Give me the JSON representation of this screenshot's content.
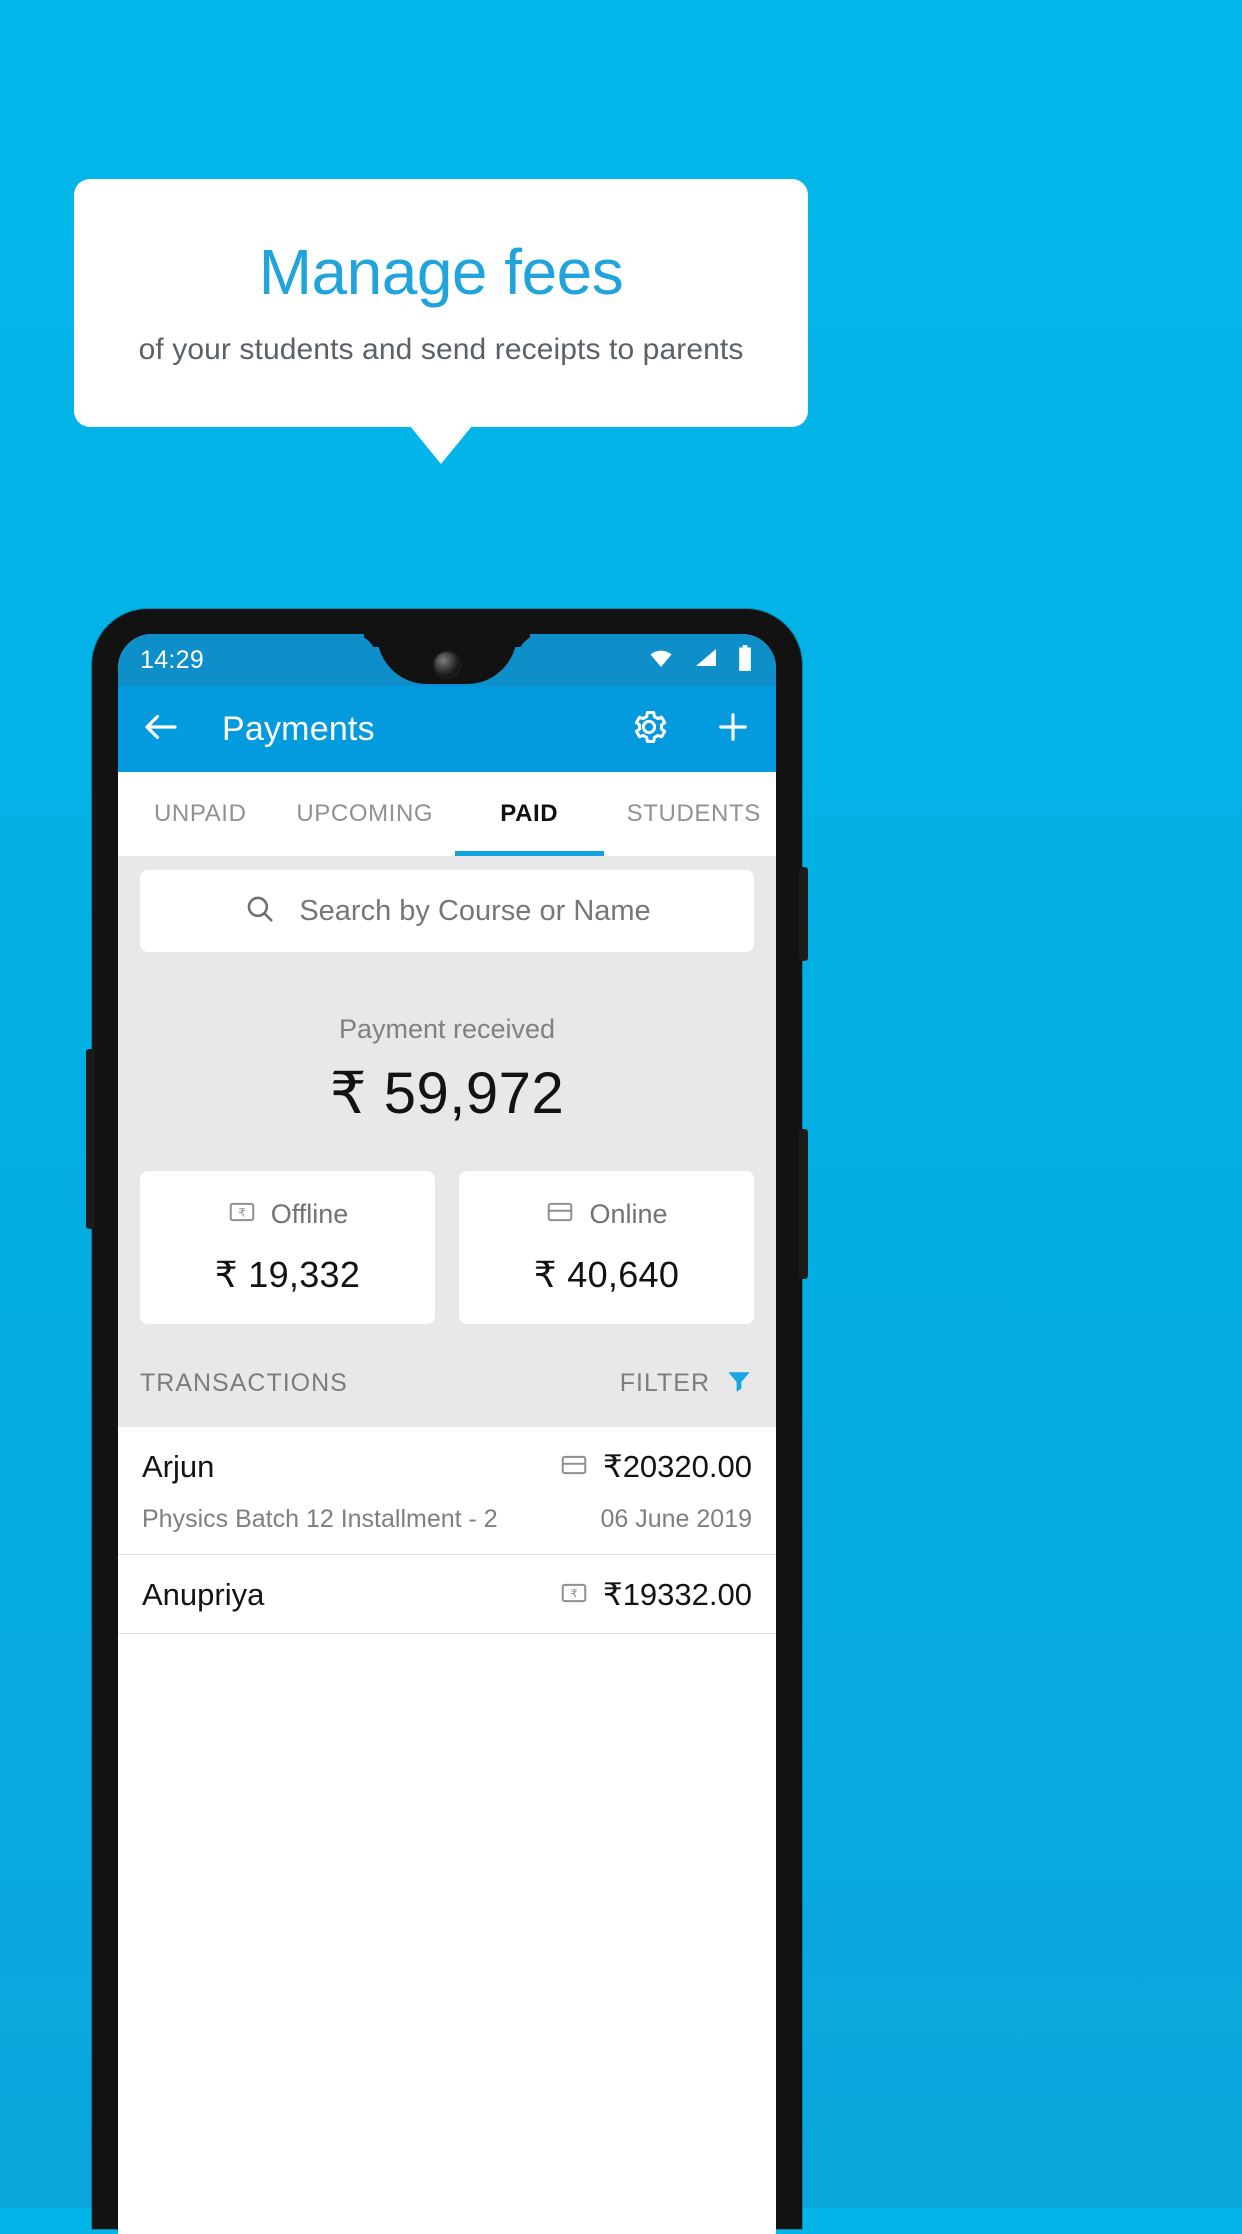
{
  "promo": {
    "title": "Manage fees",
    "subtitle": "of your students and send receipts to parents"
  },
  "colors": {
    "background": "#03b4e8",
    "bubble_title": "#21a3dc",
    "appbar": "#039ade",
    "statusbar": "#0e8fc9",
    "accent": "#11a2e0",
    "body": "#e8e8e8"
  },
  "phone": {
    "statusbar": {
      "time": "14:29",
      "icons": [
        "wifi-icon",
        "signal-icon",
        "battery-icon"
      ]
    },
    "appbar": {
      "back_icon": "back-arrow-icon",
      "title": "Payments",
      "settings_icon": "gear-icon",
      "add_icon": "plus-icon"
    },
    "tabs": [
      {
        "label": "UNPAID",
        "active": false
      },
      {
        "label": "UPCOMING",
        "active": false
      },
      {
        "label": "PAID",
        "active": true
      },
      {
        "label": "STUDENTS",
        "active": false
      }
    ],
    "search": {
      "icon": "search-icon",
      "placeholder": "Search by Course or Name",
      "value": ""
    },
    "summary": {
      "label": "Payment received",
      "amount": "₹ 59,972"
    },
    "payment_cards": [
      {
        "icon": "rupee-note-icon",
        "label": "Offline",
        "amount": "₹ 19,332"
      },
      {
        "icon": "credit-card-icon",
        "label": "Online",
        "amount": "₹ 40,640"
      }
    ],
    "transactions_header": {
      "title": "TRANSACTIONS",
      "filter_label": "FILTER",
      "filter_icon": "funnel-icon"
    },
    "transactions": [
      {
        "name": "Arjun",
        "method_icon": "credit-card-icon",
        "amount": "₹20320.00",
        "description": "Physics Batch 12 Installment - 2",
        "date": "06 June 2019"
      },
      {
        "name": "Anupriya",
        "method_icon": "rupee-note-icon",
        "amount": "₹19332.00",
        "description": "",
        "date": ""
      }
    ]
  }
}
